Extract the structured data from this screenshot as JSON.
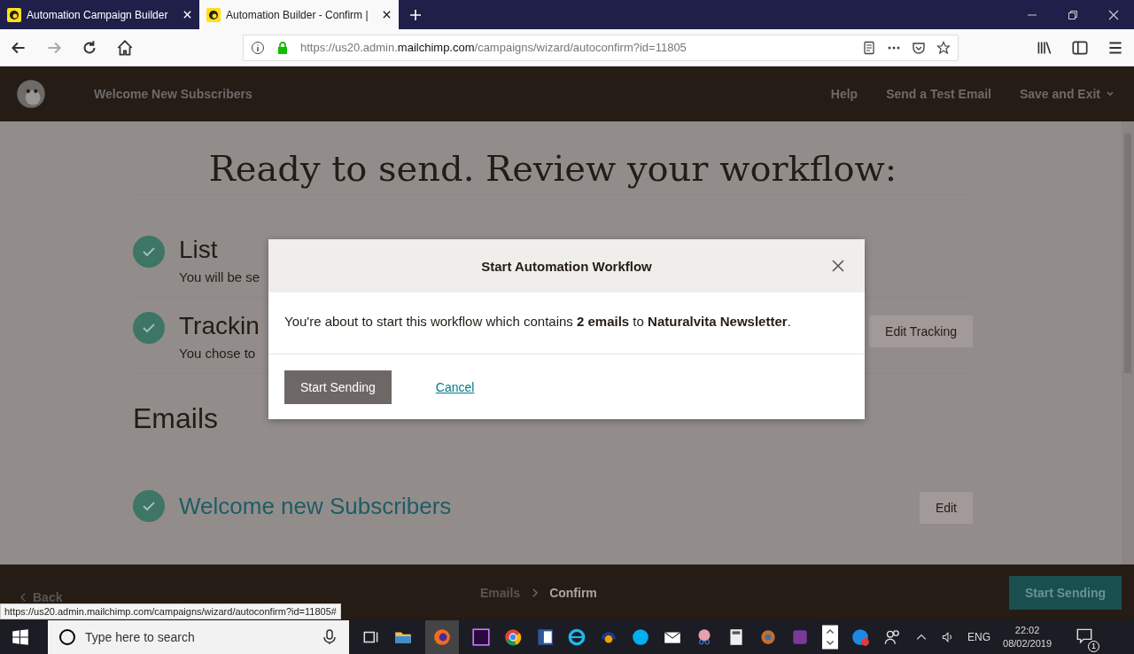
{
  "browser": {
    "tabs": [
      {
        "title": "Automation Campaign Builder",
        "selected": false
      },
      {
        "title": "Automation Builder - Confirm |",
        "selected": true
      }
    ],
    "url": {
      "prefix": "https://us20.admin.",
      "domain": "mailchimp.com",
      "path": "/campaigns/wizard/autoconfirm?id=11805"
    }
  },
  "app_header": {
    "campaign": "Welcome New Subscribers",
    "links": [
      "Help",
      "Send a Test Email"
    ],
    "save_exit": "Save and Exit"
  },
  "page": {
    "heading": "Ready to send. Review your workflow:",
    "steps": [
      {
        "title": "List",
        "description": "You will be se"
      },
      {
        "title": "Trackin",
        "description": "You chose to",
        "action": "Edit Tracking"
      }
    ],
    "emails_heading": "Emails",
    "email": {
      "title": "Welcome new Subscribers",
      "action": "Edit"
    }
  },
  "footer": {
    "back": "Back",
    "breadcrumb": [
      {
        "label": "Emails",
        "selected": false
      },
      {
        "label": "Confirm",
        "selected": true
      }
    ],
    "primary": "Start Sending"
  },
  "status_url": "https://us20.admin.mailchimp.com/campaigns/wizard/autoconfirm?id=11805#",
  "modal": {
    "title": "Start Automation Workflow",
    "body": "You're about to start this workflow which contains **2 emails** to **Naturalvita Newsletter**.",
    "primary": "Start Sending",
    "cancel": "Cancel"
  },
  "taskbar": {
    "search_placeholder": "Type here to search",
    "language": "ENG",
    "time": "22:02",
    "date": "08/02/2019",
    "notifications": "1"
  }
}
